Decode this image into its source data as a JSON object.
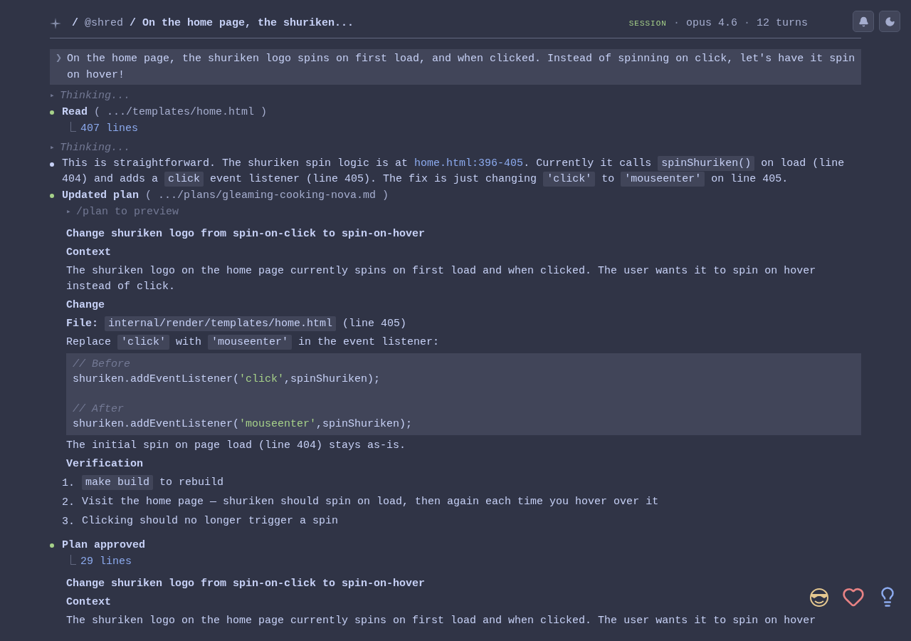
{
  "header": {
    "crumbs": [
      {
        "kind": "sep",
        "text": "/"
      },
      {
        "kind": "user",
        "text": "@shred"
      },
      {
        "kind": "title",
        "text": "/ On the home page, the shuriken..."
      }
    ],
    "meta": [
      {
        "kind": "label",
        "text": "SESSION"
      },
      {
        "kind": "dot",
        "text": "·"
      },
      {
        "kind": "info",
        "text": "opus 4.6"
      },
      {
        "kind": "dot",
        "text": "·"
      },
      {
        "kind": "info",
        "text": "12 turns"
      }
    ]
  },
  "messages": [
    {
      "kind": "user",
      "marker": "❯",
      "text": "On the home page, the shuriken logo spins on first load, and when clicked. Instead of spinning on click, let's have it spin on hover!"
    },
    {
      "kind": "thinking",
      "marker": "▸",
      "text": "Thinking..."
    },
    {
      "kind": "tool",
      "color": "#a6d189",
      "name": "Read",
      "arg": "( .../templates/home.html )",
      "result": "407 lines"
    },
    {
      "kind": "thinking",
      "marker": "▸",
      "text": "Thinking..."
    },
    {
      "kind": "text",
      "color": "#c6d0f5",
      "segments": [
        {
          "kind": "text",
          "text": "This is straightforward. The shuriken spin logic is at "
        },
        {
          "kind": "link",
          "text": "home.html:396-405"
        },
        {
          "kind": "text",
          "text": ". Currently it calls "
        },
        {
          "kind": "code",
          "text": "spinShuriken()"
        },
        {
          "kind": "text",
          "text": " on load (line 404) and adds a "
        },
        {
          "kind": "code",
          "text": "click"
        },
        {
          "kind": "text",
          "text": " event listener (line 405). The fix is just changing "
        },
        {
          "kind": "code",
          "text": "'click'"
        },
        {
          "kind": "text",
          "text": " to "
        },
        {
          "kind": "code",
          "text": "'mouseenter'"
        },
        {
          "kind": "text",
          "text": " on line 405."
        }
      ]
    },
    {
      "kind": "tool",
      "color": "#a6d189",
      "name": "Updated plan",
      "arg": "( .../plans/gleaming-cooking-nova.md )",
      "expander": {
        "marker": "▸",
        "text": "/plan to preview"
      },
      "plan": [
        {
          "kind": "h1",
          "text": "Change shuriken logo from spin-on-click to spin-on-hover"
        },
        {
          "kind": "h2",
          "text": "Context"
        },
        {
          "kind": "p",
          "segments": [
            {
              "kind": "text",
              "text": "The shuriken logo on the home page currently spins on first load and when clicked. The user wants it to spin on hover instead of click."
            }
          ]
        },
        {
          "kind": "h2",
          "text": "Change"
        },
        {
          "kind": "p",
          "segments": [
            {
              "kind": "bold",
              "text": "File:"
            },
            {
              "kind": "code",
              "text": "internal/render/templates/home.html"
            },
            {
              "kind": "text",
              "text": " (line 405)"
            }
          ]
        },
        {
          "kind": "p",
          "segments": [
            {
              "kind": "text",
              "text": "Replace "
            },
            {
              "kind": "code",
              "text": "'click'"
            },
            {
              "kind": "text",
              "text": " with "
            },
            {
              "kind": "code",
              "text": "'mouseenter'"
            },
            {
              "kind": "text",
              "text": " in the event listener:"
            }
          ]
        },
        {
          "kind": "code",
          "lines": [
            {
              "kind": "comment",
              "segments": [
                {
                  "kind": "plain",
                  "text": "// Before"
                }
              ]
            },
            {
              "kind": "code",
              "segments": [
                {
                  "kind": "plain",
                  "text": "shuriken.addEventListener("
                },
                {
                  "kind": "string",
                  "text": "'click'"
                },
                {
                  "kind": "plain",
                  "text": ",spinShuriken);"
                }
              ]
            },
            {
              "kind": "blank"
            },
            {
              "kind": "comment",
              "segments": [
                {
                  "kind": "plain",
                  "text": "// After"
                }
              ]
            },
            {
              "kind": "code",
              "segments": [
                {
                  "kind": "plain",
                  "text": "shuriken.addEventListener("
                },
                {
                  "kind": "string",
                  "text": "'mouseenter'"
                },
                {
                  "kind": "plain",
                  "text": ",spinShuriken);"
                }
              ]
            }
          ]
        },
        {
          "kind": "p",
          "segments": [
            {
              "kind": "text",
              "text": "The initial spin on page load (line 404) stays as-is."
            }
          ]
        },
        {
          "kind": "h2",
          "text": "Verification"
        },
        {
          "kind": "ol",
          "items": [
            {
              "number": "1.",
              "segments": [
                {
                  "kind": "code",
                  "text": "make build"
                },
                {
                  "kind": "text",
                  "text": " to rebuild"
                }
              ]
            },
            {
              "number": "2.",
              "segments": [
                {
                  "kind": "text",
                  "text": "Visit the home page — shuriken should spin on load, then again each time you hover over it"
                }
              ]
            },
            {
              "number": "3.",
              "segments": [
                {
                  "kind": "text",
                  "text": "Clicking should no longer trigger a spin"
                }
              ]
            }
          ]
        }
      ]
    },
    {
      "kind": "tool",
      "color": "#a6d189",
      "name": "Plan approved",
      "result": "29 lines",
      "plan": [
        {
          "kind": "h1",
          "text": "Change shuriken logo from spin-on-click to spin-on-hover"
        },
        {
          "kind": "h2",
          "text": "Context"
        },
        {
          "kind": "p",
          "segments": [
            {
              "kind": "text",
              "text": "The shuriken logo on the home page currently spins on first load and when clicked. The user wants it to spin on hover"
            }
          ]
        }
      ]
    }
  ]
}
